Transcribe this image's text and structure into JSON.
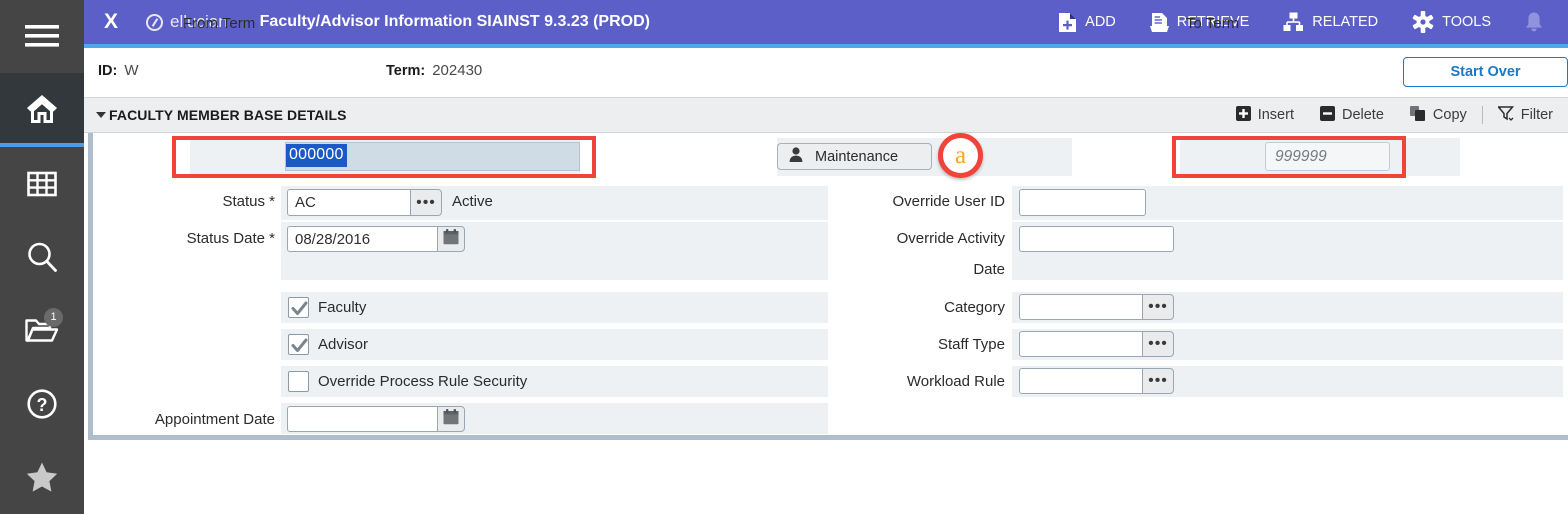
{
  "sidebar": {
    "items": [
      {
        "name": "menu",
        "icon": "hamburger-icon",
        "active": false
      },
      {
        "name": "home",
        "icon": "home-icon",
        "active": true
      },
      {
        "name": "applications",
        "icon": "grid-icon",
        "active": false
      },
      {
        "name": "search",
        "icon": "search-icon",
        "active": false
      },
      {
        "name": "recently-opened",
        "icon": "folder-open-icon",
        "active": false,
        "badge": "1"
      },
      {
        "name": "help",
        "icon": "question-circle-icon",
        "active": false
      },
      {
        "name": "favorites",
        "icon": "star-icon",
        "active": false
      }
    ],
    "badge_count": "1"
  },
  "appbar": {
    "close_label": "X",
    "brand": "ellucian",
    "title": "Faculty/Advisor Information SIAINST 9.3.23 (PROD)",
    "actions": [
      {
        "label": "ADD",
        "icon": "add-document-icon"
      },
      {
        "label": "RETRIEVE",
        "icon": "retrieve-document-icon"
      },
      {
        "label": "RELATED",
        "icon": "related-sitemap-icon"
      },
      {
        "label": "TOOLS",
        "icon": "gear-icon"
      }
    ],
    "notification_icon": "bell-icon",
    "bg_color": "#5b5fc7",
    "underline_color": "#52a7e8"
  },
  "keyblock": {
    "id_label": "ID:",
    "id_value": "W",
    "term_label": "Term:",
    "term_value": "202430",
    "start_over_label": "Start Over"
  },
  "section": {
    "title": "FACULTY MEMBER BASE DETAILS",
    "collapse_icon": "caret-down-icon",
    "actions": [
      {
        "label": "Insert",
        "icon": "plus-square-icon"
      },
      {
        "label": "Delete",
        "icon": "minus-square-icon"
      },
      {
        "label": "Copy",
        "icon": "copy-icon"
      },
      {
        "label": "Filter",
        "icon": "filter-icon"
      }
    ]
  },
  "toprow": {
    "from_term_label": "From Term",
    "from_term_value": "000000",
    "from_term_selected": true,
    "maintenance_label": "Maintenance",
    "maintenance_icon": "person-icon",
    "to_term_label": "To Term",
    "to_term_placeholder": "999999"
  },
  "annotation": {
    "marker_label": "a",
    "marker_color": "#f5a623",
    "box_color": "#f0433a"
  },
  "form": {
    "left": {
      "status_label": "Status *",
      "status_value": "AC",
      "status_description": "Active",
      "status_lov_icon": "ellipsis-lov-icon",
      "status_date_label": "Status Date *",
      "status_date_value": "08/28/2016",
      "status_date_calendar_icon": "calendar-icon",
      "faculty_label": "Faculty",
      "faculty_checked": true,
      "advisor_label": "Advisor",
      "advisor_checked": true,
      "override_rule_label": "Override Process Rule Security",
      "override_rule_checked": false,
      "appointment_date_label": "Appointment Date",
      "appointment_date_value": "",
      "appointment_date_calendar_icon": "calendar-icon"
    },
    "right": {
      "override_user_id_label": "Override User ID",
      "override_user_id_value": "",
      "override_activity_date_label_line1": "Override Activity",
      "override_activity_date_label_line2": "Date",
      "override_activity_date_value": "",
      "category_label": "Category",
      "category_value": "",
      "category_lov_icon": "ellipsis-lov-icon",
      "staff_type_label": "Staff Type",
      "staff_type_value": "",
      "staff_type_lov_icon": "ellipsis-lov-icon",
      "workload_rule_label": "Workload Rule",
      "workload_rule_value": "",
      "workload_rule_lov_icon": "ellipsis-lov-icon"
    }
  }
}
